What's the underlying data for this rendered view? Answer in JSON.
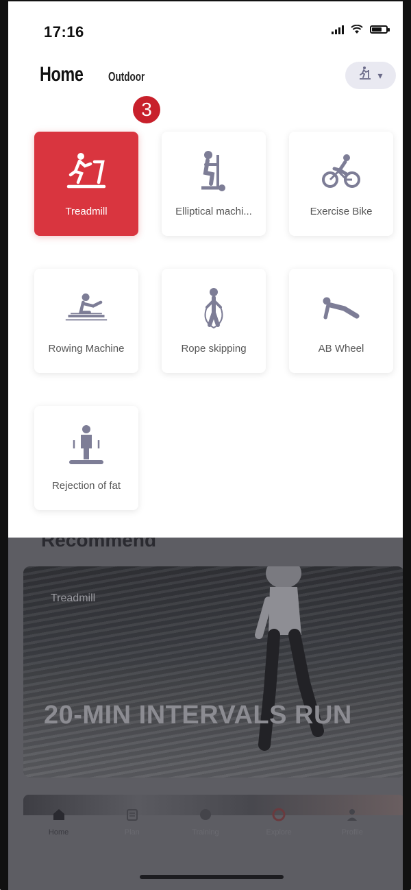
{
  "status_bar": {
    "time": "17:16"
  },
  "header": {
    "title": "Home",
    "tab_outdoor": "Outdoor",
    "device_glyph": "treadmill-icon"
  },
  "badge": {
    "number": "3"
  },
  "equipment": [
    {
      "label": "Treadmill",
      "icon": "treadmill-icon",
      "active": true
    },
    {
      "label": "Elliptical machi...",
      "icon": "elliptical-icon",
      "active": false
    },
    {
      "label": "Exercise Bike",
      "icon": "bike-icon",
      "active": false
    },
    {
      "label": "Rowing Machine",
      "icon": "rowing-icon",
      "active": false
    },
    {
      "label": "Rope skipping",
      "icon": "rope-skipping-icon",
      "active": false
    },
    {
      "label": "AB Wheel",
      "icon": "ab-wheel-icon",
      "active": false
    },
    {
      "label": "Rejection of fat",
      "icon": "fat-rejection-icon",
      "active": false
    }
  ],
  "recommend": {
    "title": "Recommend",
    "more": "",
    "banner": {
      "category": "Treadmill",
      "name": "20-MIN INTERVALS RUN",
      "meta": ""
    }
  },
  "tabbar": [
    {
      "label": "Home",
      "icon": "home-icon",
      "active": true
    },
    {
      "label": "Plan",
      "icon": "plan-icon",
      "active": false
    },
    {
      "label": "Training",
      "icon": "training-icon",
      "active": false
    },
    {
      "label": "Explore",
      "icon": "explore-icon",
      "active": false
    },
    {
      "label": "Profile",
      "icon": "profile-icon",
      "active": false
    }
  ],
  "colors": {
    "accent": "#d9353f",
    "badge": "#c8202b",
    "icon_gray": "#7d7d96"
  }
}
